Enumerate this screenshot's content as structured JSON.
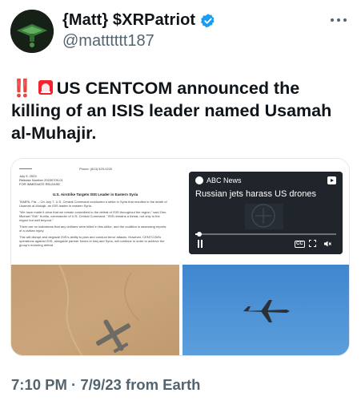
{
  "author": {
    "display_name": "{Matt} $XRPatriot",
    "handle": "@matttttt187",
    "verified": true,
    "avatar_icon": "avatar-image"
  },
  "tweet": {
    "prefix_emoji": "‼️",
    "siren_emoji": "🚨",
    "text": "US CENTCOM announced the killing of an ISIS leader named Usamah al-Muhajir."
  },
  "media": {
    "press_release": {
      "phone": "Phone: (813) 529-0220",
      "date": "July 9, 2023",
      "release_number": "Release Number 20230709-01",
      "release_type": "FOR IMMEDIATE RELEASE",
      "headline": "U.S. Airstrike Targets ISIS Leader in Eastern Syria",
      "paragraphs": [
        "TAMPA, Fla. – On July 7, U.S. Central Command conducted a strike in Syria that resulted in the death of Usamah al-Muhajir, an ISIS leader in eastern Syria.",
        "\"We have made it clear that we remain committed to the defeat of ISIS throughout the region,\" said Gen. Michael \"Erik\" Kurilla, commander of U.S. Central Command. \"ISIS remains a threat, not only to the region but well beyond.\"",
        "There are no indications that any civilians were killed in this strike, and the coalition is assessing reports of a civilian injury.",
        "This will disrupt and degrade ISIS's ability to plan and conduct terror attacks. However, CENTCOM's operations against ISIS, alongside partner forces in Iraq and Syria, will continue in order to achieve the group's enduring defeat."
      ]
    },
    "video": {
      "source": "ABC News",
      "title": "Russian jets harass US drones",
      "progress": 0.03,
      "cc_label": "CC"
    }
  },
  "footer": {
    "timestamp": "7:10 PM · 7/9/23 from Earth"
  },
  "colors": {
    "text": "#0f1419",
    "secondary": "#536471",
    "verified": "#1d9bf0",
    "bang": "#e0245e"
  }
}
